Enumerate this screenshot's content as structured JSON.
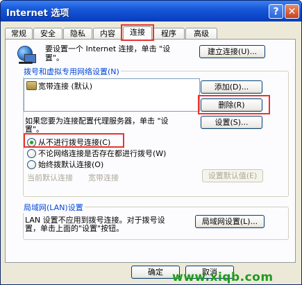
{
  "window": {
    "title": "Internet 选项",
    "help_glyph": "?",
    "close_glyph": "✕"
  },
  "tabs": [
    "常规",
    "安全",
    "隐私",
    "内容",
    "连接",
    "程序",
    "高级"
  ],
  "active_tab": "连接",
  "setup": {
    "text_line1": "要设置一个 Internet 连接，单击 \"设",
    "text_line2": "置\"。",
    "button": "建立连接(U)..."
  },
  "dialup": {
    "group_label": "拨号和虚拟专用网络设置(N)",
    "items": [
      "宽带连接 (默认)"
    ],
    "add_button": "添加(D)...",
    "remove_button": "删除(R)",
    "settings_button": "设置(S)...",
    "proxy_text_line1": "如果您要为连接配置代理服务器，单击 \"设",
    "proxy_text_line2": "置\"。",
    "options": [
      {
        "label": "从不进行拨号连接(C)",
        "checked": true
      },
      {
        "label": "不论网络连接是否存在都进行拨号(W)",
        "checked": false
      },
      {
        "label": "始终拨默认连接(O)",
        "checked": false
      }
    ],
    "current_default_label": "当前默认连接",
    "current_default_value": "宽带连接",
    "set_default_button": "设置默认值(E)"
  },
  "lan": {
    "group_label": "局域网(LAN)设置",
    "text_line1": "LAN 设置不应用到拨号连接。对于拨号设",
    "text_line2": "置，单击上面的\"设置\"按钮。",
    "button": "局域网设置(L)..."
  },
  "footer": {
    "ok_button": "确定",
    "cancel_button": "取消"
  },
  "watermark": "www.xiqb.com",
  "colors": {
    "highlight": "#e8322f",
    "titlebar": "#0a43c6",
    "group_label": "#0046d5",
    "watermark": "#1e9b1e"
  }
}
